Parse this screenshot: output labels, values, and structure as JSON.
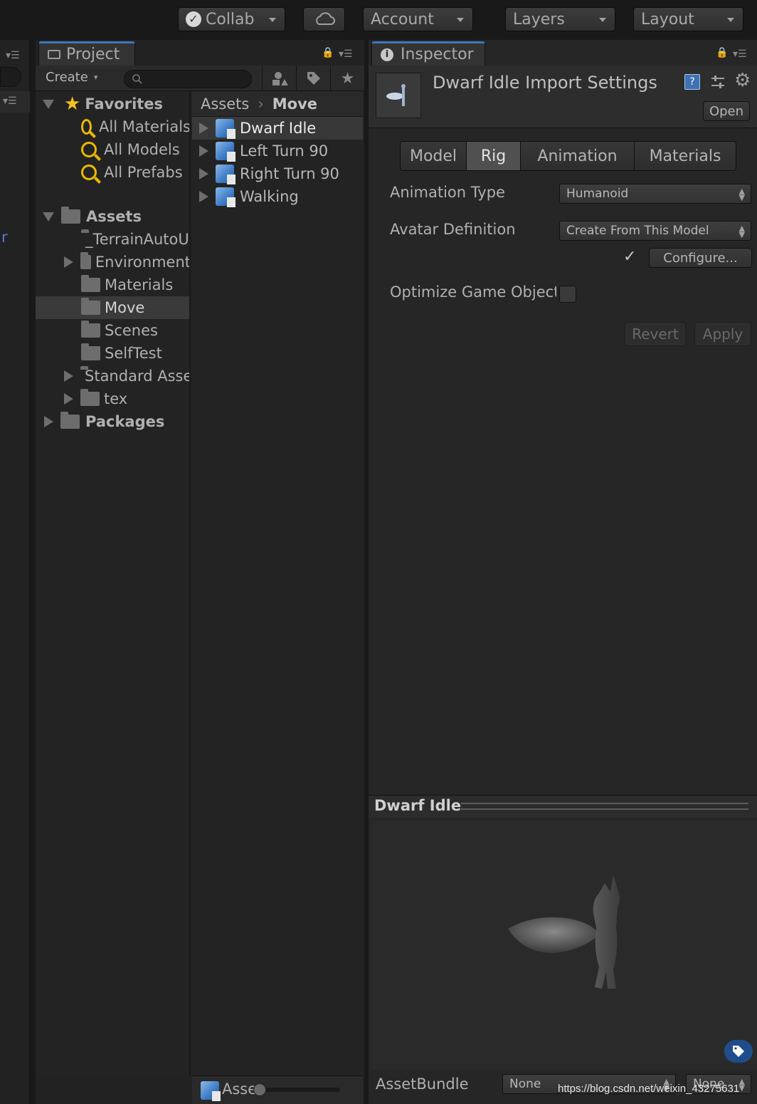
{
  "toolbar": {
    "collab_label": "Collab",
    "account_label": "Account",
    "layers_label": "Layers",
    "layout_label": "Layout"
  },
  "left_strip": {
    "partial_text": "r"
  },
  "project": {
    "tab_label": "Project",
    "create_label": "Create",
    "favorites": {
      "label": "Favorites",
      "items": [
        "All Materials",
        "All Models",
        "All Prefabs"
      ]
    },
    "assets": {
      "label": "Assets",
      "items": [
        "_TerrainAutoUpgrade",
        "Environment",
        "Materials",
        "Move",
        "Scenes",
        "SelfTest",
        "Standard Assets",
        "tex"
      ]
    },
    "packages_label": "Packages",
    "breadcrumb": {
      "root": "Assets",
      "current": "Move"
    },
    "files": [
      "Dwarf Idle",
      "Left Turn 90",
      "Right Turn 90",
      "Walking"
    ],
    "bottom_path": "Assets"
  },
  "inspector": {
    "tab_label": "Inspector",
    "title": "Dwarf Idle Import Settings",
    "open_label": "Open",
    "tabs": [
      "Model",
      "Rig",
      "Animation",
      "Materials"
    ],
    "animation_type_label": "Animation Type",
    "animation_type_value": "Humanoid",
    "avatar_definition_label": "Avatar Definition",
    "avatar_definition_value": "Create From This Model",
    "check_mark": "✓",
    "configure_label": "Configure...",
    "optimize_label": "Optimize Game Objects",
    "revert_label": "Revert",
    "apply_label": "Apply",
    "preview_title": "Dwarf Idle",
    "assetbundle_label": "AssetBundle",
    "assetbundle_name": "None",
    "assetbundle_variant": "None"
  },
  "watermark": "https://blog.csdn.net/weixin_43275631",
  "colors": {
    "accent_tab": "#3a79bb",
    "favorite_star": "#f4c21e",
    "search_icon": "#e9b800",
    "model_cube": "#3d7cc5"
  },
  "icons": [
    "collab-check-icon",
    "cloud-icon",
    "folder-icon",
    "lock-icon",
    "panel-menu-icon",
    "search-icon",
    "star-icon",
    "magnifier-icon",
    "model-cube-icon",
    "help-icon",
    "preset-icon",
    "gear-icon",
    "info-icon",
    "label-tag-icon"
  ]
}
